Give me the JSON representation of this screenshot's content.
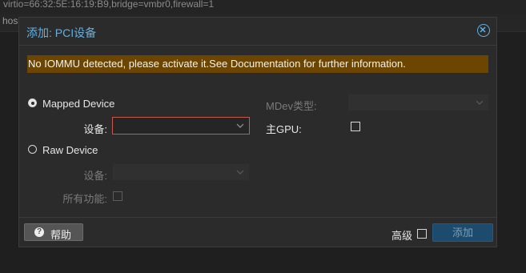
{
  "background": {
    "line1": "virtio=66:32:5E:16:19:B9,bridge=vmbr0,firewall=1",
    "line2": "hos"
  },
  "dialog": {
    "title": "添加: PCI设备",
    "warning": "No IOMMU detected, please activate it.See Documentation for further information.",
    "mapped_device": {
      "label": "Mapped Device",
      "selected": true
    },
    "mapped_device_field": {
      "label": "设备:",
      "value": ""
    },
    "mdev_type": {
      "label": "MDev类型:",
      "value": ""
    },
    "primary_gpu": {
      "label": "主GPU:",
      "checked": false
    },
    "raw_device": {
      "label": "Raw Device",
      "selected": false
    },
    "raw_device_field": {
      "label": "设备:",
      "value": ""
    },
    "all_functions": {
      "label": "所有功能:",
      "checked": false
    },
    "footer": {
      "help_label": "帮助",
      "advanced_label": "高级",
      "advanced_checked": false,
      "add_label": "添加"
    }
  },
  "colors": {
    "accent": "#5fb1e8",
    "warning_bg": "#6c4600",
    "error_border": "#c65a4a",
    "primary_button": "#1c4b6d"
  },
  "icons": [
    "close-icon",
    "chevron-down-icon",
    "question-circle-icon"
  ]
}
